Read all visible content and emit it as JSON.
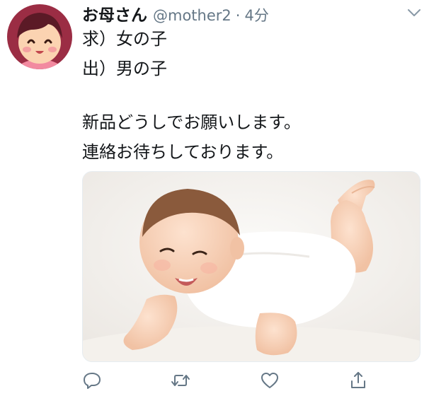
{
  "tweet": {
    "display_name": "お母さん",
    "handle": "@mother2",
    "separator": "·",
    "time": "4分",
    "lines": [
      "求）女の子",
      "出）男の子",
      "新品どうしでお願いします。",
      "連絡お待ちしております。"
    ]
  },
  "icons": {
    "avatar": "cartoon-mother-avatar",
    "menu": "chevron-down-icon",
    "reply": "reply-icon",
    "retweet": "retweet-icon",
    "like": "heart-icon",
    "share": "share-icon"
  },
  "colors": {
    "text": "#14171a",
    "secondary": "#657786",
    "action": "#657786",
    "avatar_bg": "#9b2d44",
    "media_border": "#e6ecf0"
  }
}
